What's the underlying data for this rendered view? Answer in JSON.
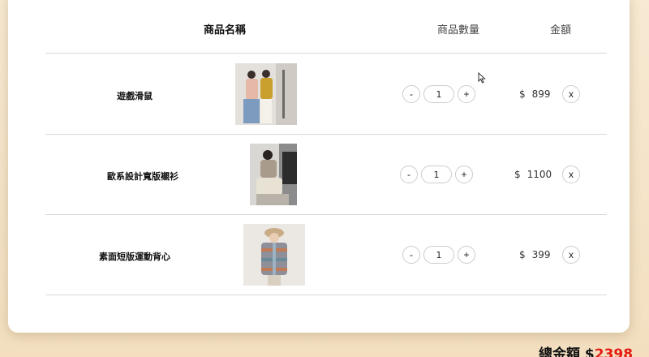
{
  "table": {
    "header_name": "商品名稱",
    "header_qty": "商品數量",
    "header_amount": "金額"
  },
  "items": [
    {
      "name": "遊戲滑鼠",
      "qty": "1",
      "currency": "$",
      "price": "899",
      "minus": "-",
      "plus": "+",
      "remove": "x"
    },
    {
      "name": "歐系設計寬版襯衫",
      "qty": "1",
      "currency": "$",
      "price": "1100",
      "minus": "-",
      "plus": "+",
      "remove": "x"
    },
    {
      "name": "素面短版運動背心",
      "qty": "1",
      "currency": "$",
      "price": "399",
      "minus": "-",
      "plus": "+",
      "remove": "x"
    }
  ],
  "summary": {
    "total_label": "總金額",
    "currency": "$",
    "total_value": "2398"
  },
  "colors": {
    "accent": "#e41b13",
    "background": "#f3dfc0"
  }
}
